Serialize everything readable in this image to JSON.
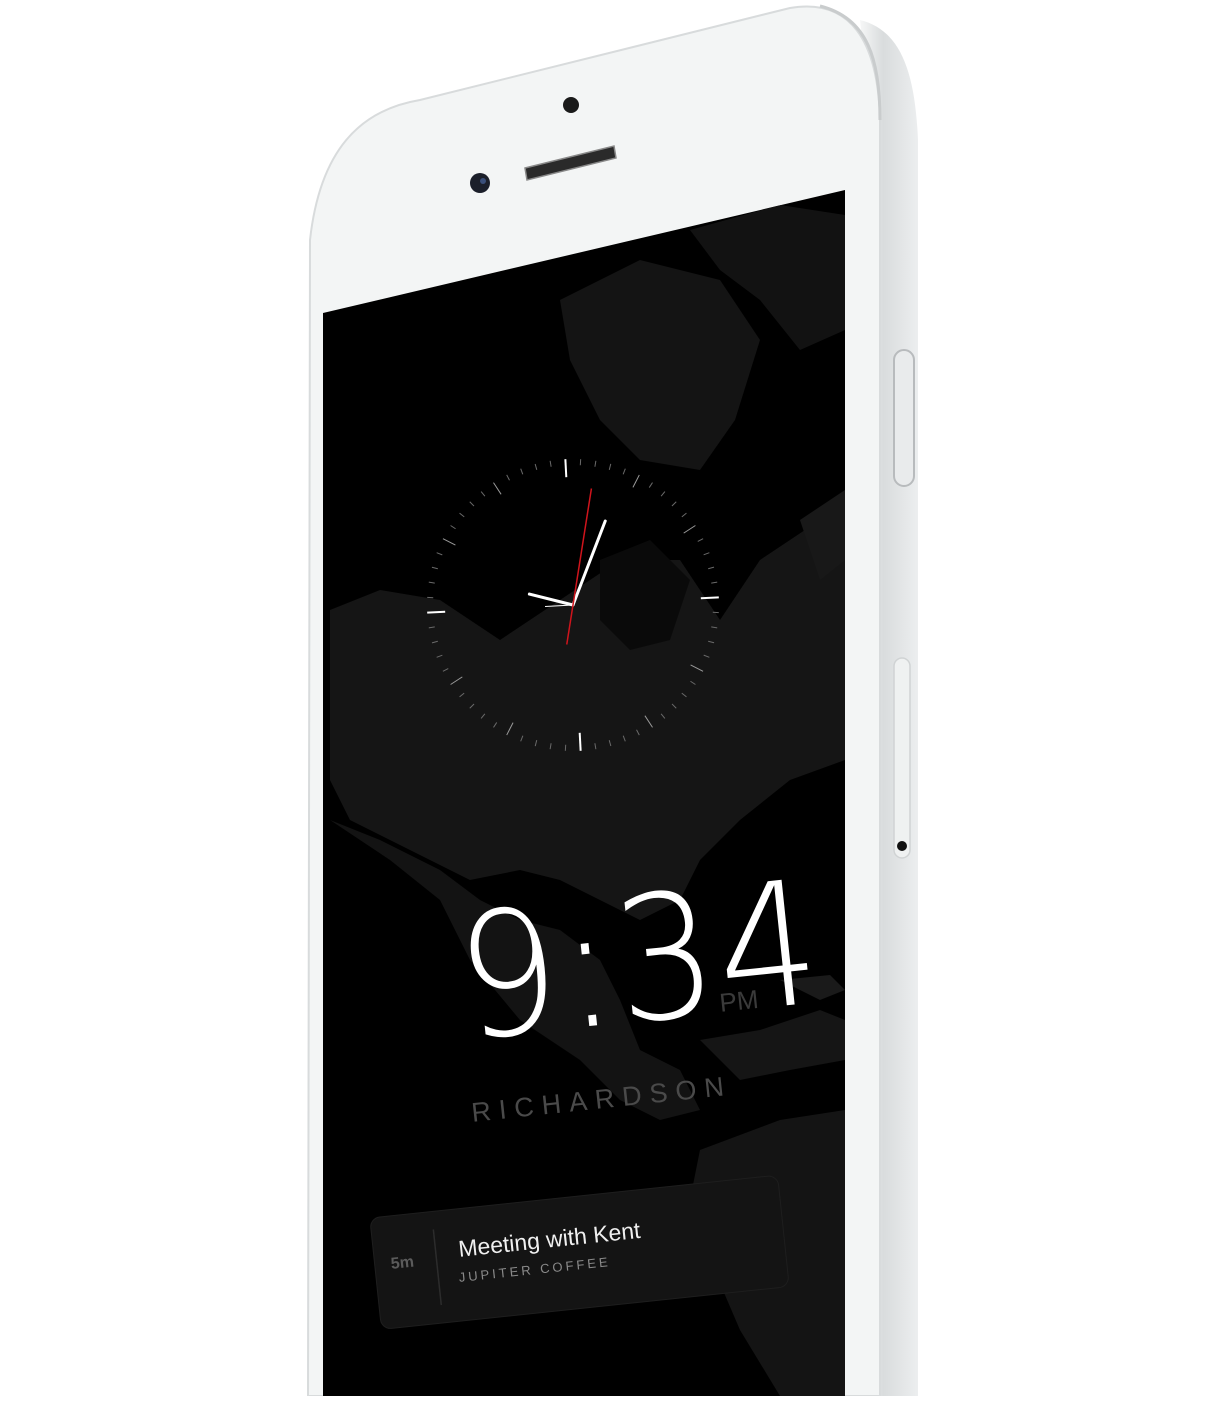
{
  "clock": {
    "time": "9:34",
    "period": "PM",
    "city": "RICHARDSON",
    "analog": {
      "hour": 9,
      "minute": 34,
      "second_hand_minute": 2
    },
    "second_hand_color": "#d0141c"
  },
  "event_card": {
    "duration": "5m",
    "title": "Meeting with Kent",
    "location": "JUPITER COFFEE"
  },
  "colors": {
    "screen_bg": "#000000",
    "map_land": "#161616",
    "phone_body": "#f3f5f5",
    "frame_silver": "#dfe1e2"
  }
}
